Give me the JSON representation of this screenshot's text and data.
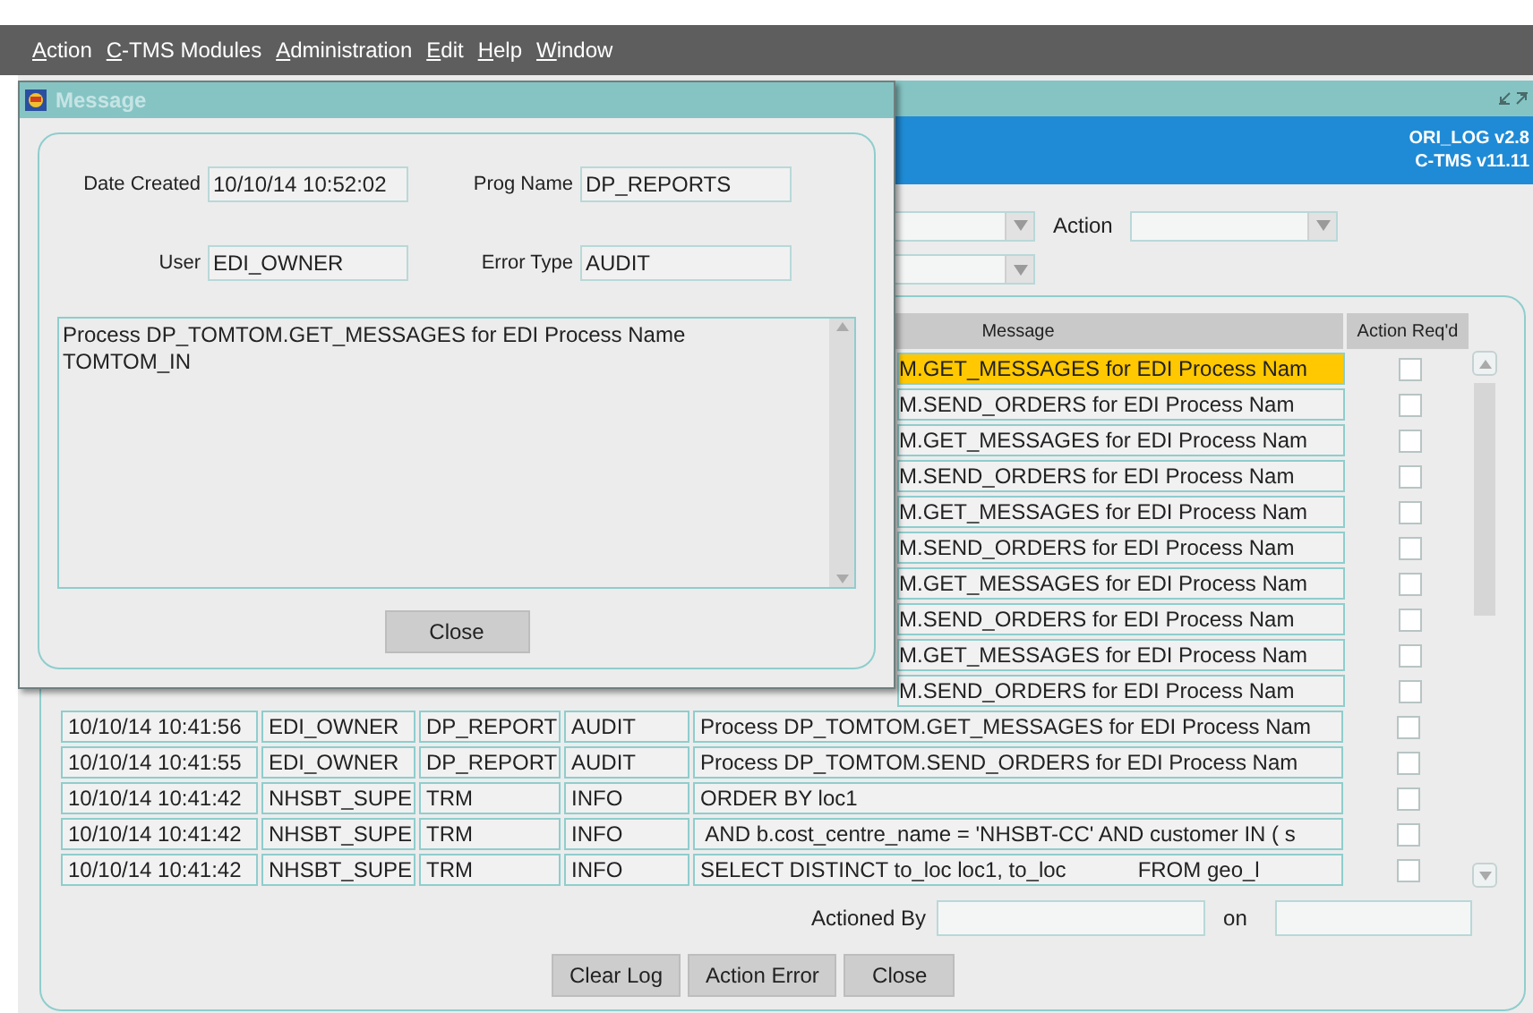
{
  "menu": [
    {
      "label": "Action"
    },
    {
      "label": "C-TMS Modules"
    },
    {
      "label": "Administration"
    },
    {
      "label": "Edit"
    },
    {
      "label": "Help"
    },
    {
      "label": "Window"
    }
  ],
  "header": {
    "lines": [
      "ORI_LOG v2.8",
      "C-TMS v11.11"
    ]
  },
  "filters": {
    "rows": [
      [
        {
          "kind": "dropdown"
        },
        {
          "kind": "dropdown",
          "label": "Action"
        }
      ],
      [
        {
          "kind": "dropdown"
        }
      ]
    ]
  },
  "table": {
    "columns": [
      {
        "label": "Message"
      },
      {
        "label": "Action Req'd"
      }
    ],
    "rows": [
      {
        "kind": "covered",
        "message": "M.GET_MESSAGES for EDI Process Nam",
        "action_reqd": false,
        "selected": true
      },
      {
        "kind": "covered",
        "message": "M.SEND_ORDERS for EDI Process Nam",
        "action_reqd": false,
        "selected": false
      },
      {
        "kind": "covered",
        "message": "M.GET_MESSAGES for EDI Process Nam",
        "action_reqd": false,
        "selected": false
      },
      {
        "kind": "covered",
        "message": "M.SEND_ORDERS for EDI Process Nam",
        "action_reqd": false,
        "selected": false
      },
      {
        "kind": "covered",
        "message": "M.GET_MESSAGES for EDI Process Nam",
        "action_reqd": false,
        "selected": false
      },
      {
        "kind": "covered",
        "message": "M.SEND_ORDERS for EDI Process Nam",
        "action_reqd": false,
        "selected": false
      },
      {
        "kind": "covered",
        "message": "M.GET_MESSAGES for EDI Process Nam",
        "action_reqd": false,
        "selected": false
      },
      {
        "kind": "covered",
        "message": "M.SEND_ORDERS for EDI Process Nam",
        "action_reqd": false,
        "selected": false
      },
      {
        "kind": "covered",
        "message": "M.GET_MESSAGES for EDI Process Nam",
        "action_reqd": false,
        "selected": false
      },
      {
        "kind": "covered",
        "message": "M.SEND_ORDERS for EDI Process Nam",
        "action_reqd": false,
        "selected": false
      },
      {
        "kind": "full",
        "column_1": "10/10/14 10:41:56",
        "column_2": "EDI_OWNER",
        "column_3": "DP_REPORT",
        "column_4": "AUDIT",
        "message": "Process DP_TOMTOM.GET_MESSAGES for EDI Process Nam",
        "action_reqd": false,
        "selected": false
      },
      {
        "kind": "full",
        "column_1": "10/10/14 10:41:55",
        "column_2": "EDI_OWNER",
        "column_3": "DP_REPORT",
        "column_4": "AUDIT",
        "message": "Process DP_TOMTOM.SEND_ORDERS for EDI Process Nam",
        "action_reqd": false,
        "selected": false
      },
      {
        "kind": "full",
        "column_1": "10/10/14 10:41:42",
        "column_2": "NHSBT_SUPE",
        "column_3": "TRM",
        "column_4": "INFO",
        "message": "ORDER BY loc1",
        "action_reqd": false,
        "selected": false
      },
      {
        "kind": "full",
        "column_1": "10/10/14 10:41:42",
        "column_2": "NHSBT_SUPE",
        "column_3": "TRM",
        "column_4": "INFO",
        "message": " AND b.cost_centre_name = 'NHSBT-CC' AND customer IN ( s",
        "action_reqd": false,
        "selected": false
      },
      {
        "kind": "full",
        "column_1": "10/10/14 10:41:42",
        "column_2": "NHSBT_SUPE",
        "column_3": "TRM",
        "column_4": "INFO",
        "message": "SELECT DISTINCT to_loc loc1, to_loc            FROM geo_l",
        "action_reqd": false,
        "selected": false
      }
    ]
  },
  "actioned_by": {
    "label": "Actioned By",
    "on_label": "on"
  },
  "buttons": [
    {
      "label": "Clear Log"
    },
    {
      "label": "Action Error"
    },
    {
      "label": "Close"
    }
  ],
  "dialog": {
    "title": "Message",
    "fields": [
      {
        "label": "Date Created",
        "value": "10/10/14 10:52:02"
      },
      {
        "label": "Prog Name",
        "value": "DP_REPORTS"
      },
      {
        "label": "User",
        "value": "EDI_OWNER"
      },
      {
        "label": "Error Type",
        "value": "AUDIT"
      }
    ],
    "message": "Process DP_TOMTOM.GET_MESSAGES for EDI Process Name TOMTOM_IN",
    "button": "Close"
  }
}
